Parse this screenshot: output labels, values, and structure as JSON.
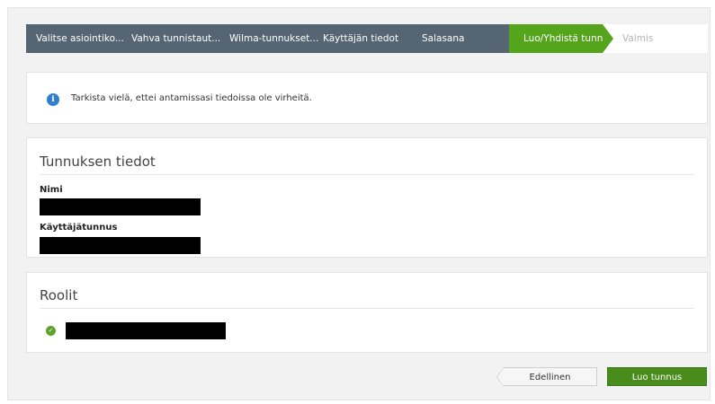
{
  "wizard": {
    "steps": [
      {
        "label": "Valitse asiointiko...",
        "state": "completed"
      },
      {
        "label": "Vahva tunnistaut...",
        "state": "completed"
      },
      {
        "label": "Wilma-tunnukset...",
        "state": "completed"
      },
      {
        "label": "Käyttäjän tiedot",
        "state": "completed"
      },
      {
        "label": "Salasana",
        "state": "completed"
      },
      {
        "label": "Luo/Yhdistä tunn...",
        "state": "active"
      },
      {
        "label": "Valmis",
        "state": "upcoming"
      }
    ]
  },
  "info": {
    "icon": "info-icon",
    "text": "Tarkista vielä, ettei antamissasi tiedoissa ole virheitä."
  },
  "account": {
    "title": "Tunnuksen tiedot",
    "name_label": "Nimi",
    "username_label": "Käyttäjätunnus"
  },
  "roles": {
    "title": "Roolit",
    "icon": "check-circle-icon"
  },
  "actions": {
    "previous_label": "Edellinen",
    "create_label": "Luo tunnus"
  },
  "colors": {
    "wizard_bg": "#566573",
    "active_step": "#55a51c",
    "primary_button": "#4a8c1c",
    "info_icon": "#2f7fcc"
  }
}
